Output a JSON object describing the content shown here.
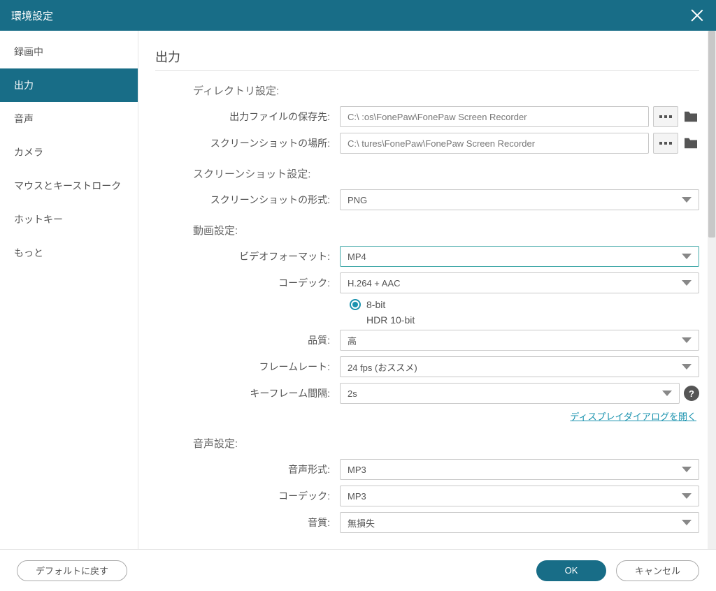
{
  "titlebar": {
    "title": "環境設定"
  },
  "sidebar": {
    "items": [
      {
        "label": "録画中"
      },
      {
        "label": "出力"
      },
      {
        "label": "音声"
      },
      {
        "label": "カメラ"
      },
      {
        "label": "マウスとキーストローク"
      },
      {
        "label": "ホットキー"
      },
      {
        "label": "もっと"
      }
    ],
    "active_index": 1
  },
  "page": {
    "title": "出力",
    "sections": {
      "directory": {
        "title": "ディレクトリ設定:",
        "output_path_label": "出力ファイルの保存先:",
        "output_path_value": "C:\\                         :os\\FonePaw\\FonePaw Screen Recorder",
        "screenshot_path_label": "スクリーンショットの場所:",
        "screenshot_path_value": "C:\\                       tures\\FonePaw\\FonePaw Screen Recorder"
      },
      "screenshot": {
        "title": "スクリーンショット設定:",
        "format_label": "スクリーンショットの形式:",
        "format_value": "PNG"
      },
      "video": {
        "title": "動画設定:",
        "format_label": "ビデオフォーマット:",
        "format_value": "MP4",
        "codec_label": "コーデック:",
        "codec_value": "H.264 + AAC",
        "bit_8": "8-bit",
        "bit_hdr": "HDR 10-bit",
        "quality_label": "品質:",
        "quality_value": "高",
        "framerate_label": "フレームレート:",
        "framerate_value": "24 fps (おススメ)",
        "keyframe_label": "キーフレーム間隔:",
        "keyframe_value": "2s",
        "display_dialog_link": "ディスプレイダイアログを開く"
      },
      "audio": {
        "title": "音声設定:",
        "format_label": "音声形式:",
        "format_value": "MP3",
        "codec_label": "コーデック:",
        "codec_value": "MP3",
        "quality_label": "音質:",
        "quality_value": "無損失"
      }
    }
  },
  "footer": {
    "reset": "デフォルトに戻す",
    "ok": "OK",
    "cancel": "キャンセル"
  }
}
